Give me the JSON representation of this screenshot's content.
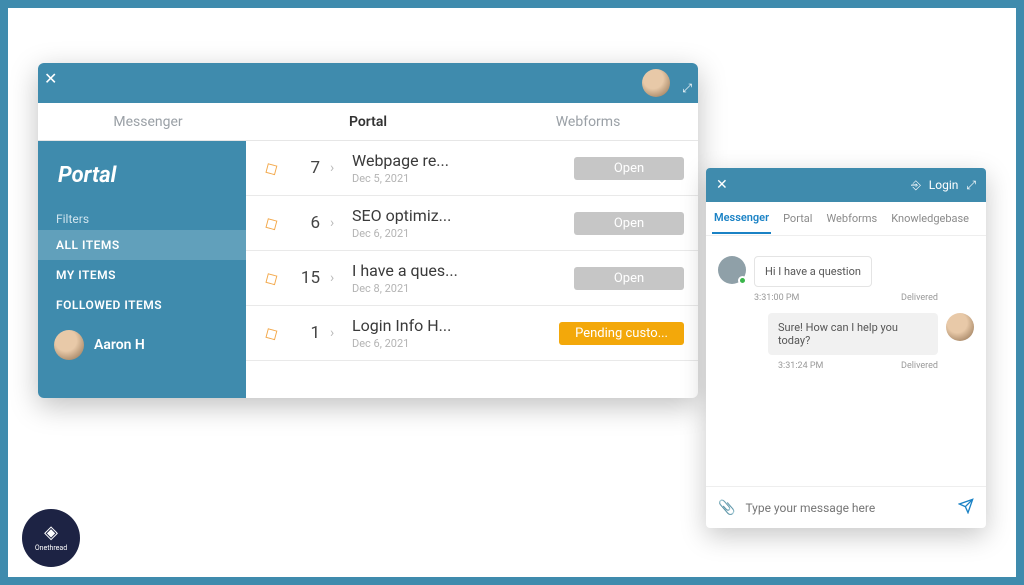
{
  "portal": {
    "tabs": [
      "Messenger",
      "Portal",
      "Webforms"
    ],
    "active_tab": 1,
    "sidebar": {
      "title": "Portal",
      "filters_label": "Filters",
      "items": [
        {
          "label": "ALL ITEMS",
          "active": true
        },
        {
          "label": "MY ITEMS",
          "active": false
        },
        {
          "label": "FOLLOWED ITEMS",
          "active": false
        }
      ],
      "user_name": "Aaron H"
    },
    "tickets": [
      {
        "num": "7",
        "title": "Webpage re...",
        "date": "Dec 5, 2021",
        "status": "Open",
        "status_type": "open"
      },
      {
        "num": "6",
        "title": "SEO optimiz...",
        "date": "Dec 6, 2021",
        "status": "Open",
        "status_type": "open"
      },
      {
        "num": "15",
        "title": "I have a ques...",
        "date": "Dec 8, 2021",
        "status": "Open",
        "status_type": "open"
      },
      {
        "num": "1",
        "title": "Login Info H...",
        "date": "Dec 6, 2021",
        "status": "Pending custo...",
        "status_type": "pending"
      }
    ]
  },
  "messenger": {
    "login_label": "Login",
    "tabs": [
      "Messenger",
      "Portal",
      "Webforms",
      "Knowledgebase"
    ],
    "active_tab": 0,
    "messages": [
      {
        "side": "left",
        "text": "Hi I have a question",
        "time": "3:31:00 PM",
        "status": "Delivered"
      },
      {
        "side": "right",
        "text": "Sure! How can I help you today?",
        "time": "3:31:24 PM",
        "status": "Delivered"
      }
    ],
    "input_placeholder": "Type your message here"
  },
  "brand": {
    "name": "Onethread"
  }
}
